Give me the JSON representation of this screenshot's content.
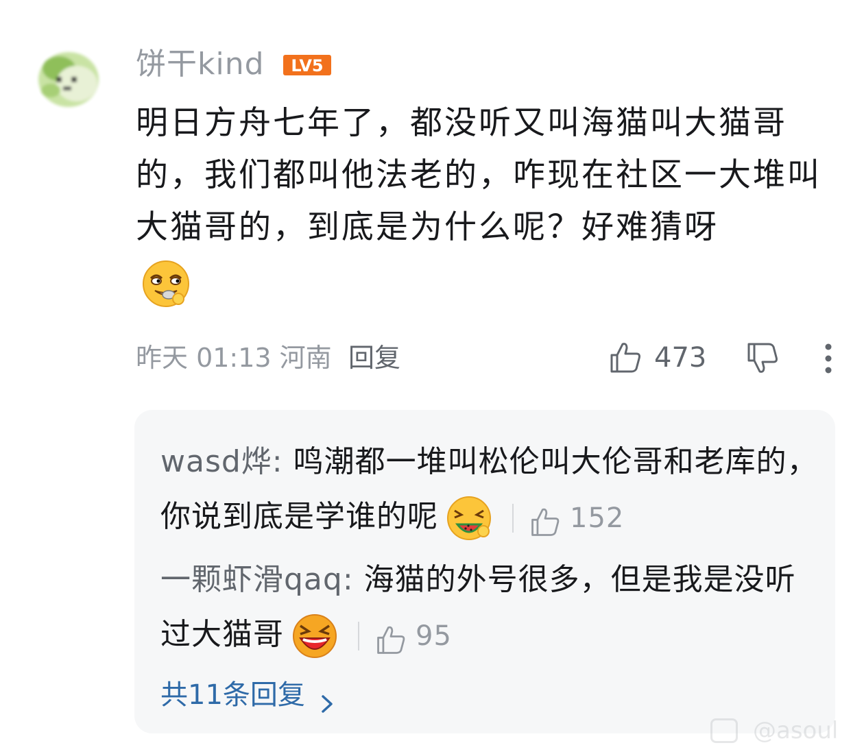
{
  "comment": {
    "username": "饼干kind",
    "level": "LV5",
    "text": "明日方舟七年了，都没听又叫海猫叫大猫哥的，我们都叫他法老的，咋现在社区一大堆叫大猫哥的，到底是为什么呢？好难猜呀",
    "emoji": "smirk-emoji",
    "time_location": "昨天 01:13 河南",
    "reply_label": "回复",
    "like_count": "473"
  },
  "replies": {
    "items": [
      {
        "username": "wasd烨:",
        "text": " 鸣潮都一堆叫松伦叫大伦哥和老库的，你说到底是学谁的呢",
        "emoji": "watermelon-emoji",
        "like_count": "152"
      },
      {
        "username": "一颗虾滑qaq:",
        "text": " 海猫的外号很多，但是我是没听过大猫哥",
        "emoji": "laughing-emoji",
        "like_count": "95"
      }
    ],
    "total_label": "共11条回复"
  },
  "watermark": {
    "text": "@asoul"
  },
  "colors": {
    "level_badge": "#f2711c",
    "link": "#2e6aa8",
    "muted": "#9499a0",
    "reply_bg": "#f6f7f8"
  }
}
